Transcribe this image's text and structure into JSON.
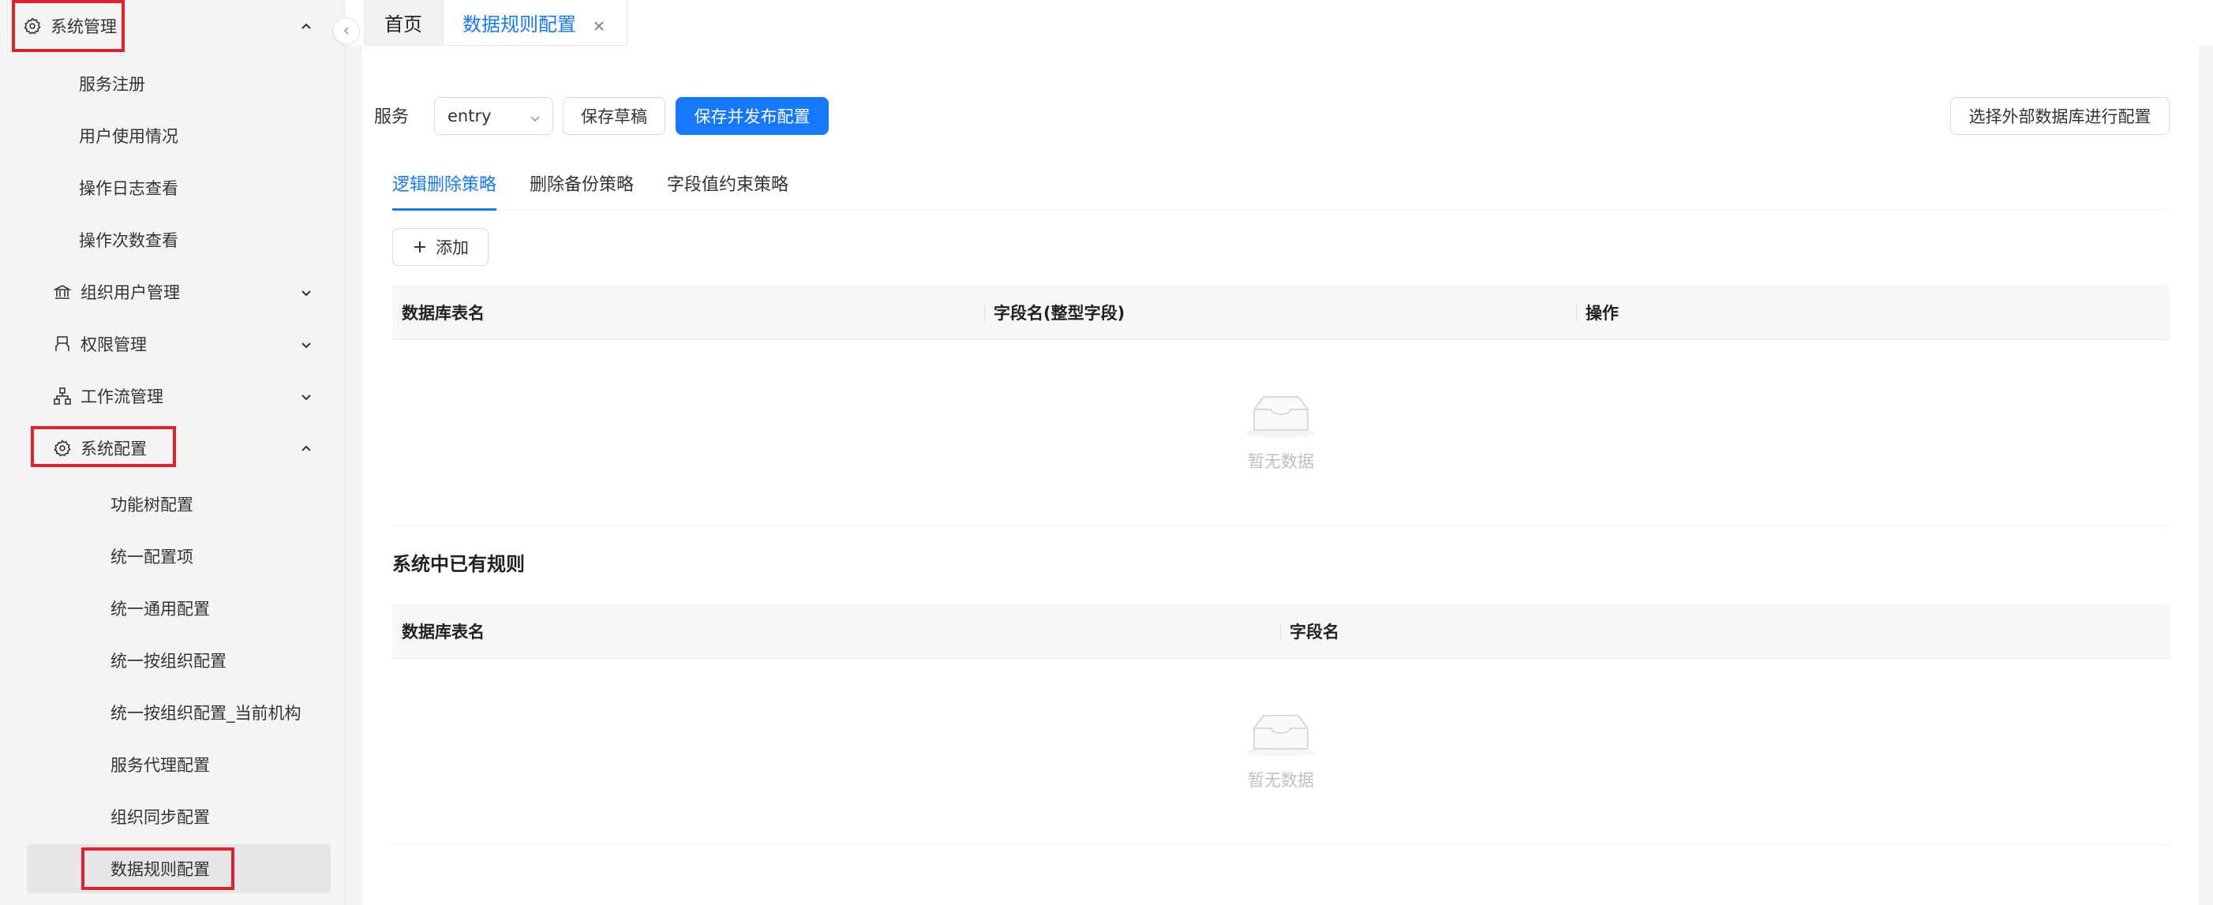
{
  "sidebar": {
    "group_system": "系统管理",
    "items_top": [
      "服务注册",
      "用户使用情况",
      "操作日志查看",
      "操作次数查看"
    ],
    "org_user": "组织用户管理",
    "permission": "权限管理",
    "workflow": "工作流管理",
    "sys_config": "系统配置",
    "config_items": [
      "功能树配置",
      "统一配置项",
      "统一通用配置",
      "统一按组织配置",
      "统一按组织配置_当前机构",
      "服务代理配置",
      "组织同步配置",
      "数据规则配置"
    ]
  },
  "tabs": {
    "home": "首页",
    "active": "数据规则配置"
  },
  "toolbar": {
    "service_label": "服务",
    "service_value": "entry",
    "save_draft": "保存草稿",
    "save_publish": "保存并发布配置",
    "external_db": "选择外部数据库进行配置"
  },
  "subtabs": [
    "逻辑删除策略",
    "删除备份策略",
    "字段值约束策略"
  ],
  "add_button": "添加",
  "table1": {
    "columns": [
      "数据库表名",
      "字段名(整型字段)",
      "操作"
    ],
    "empty_text": "暂无数据"
  },
  "section_title": "系统中已有规则",
  "table2": {
    "columns": [
      "数据库表名",
      "字段名"
    ],
    "empty_text": "暂无数据"
  },
  "colors": {
    "primary": "#1677ff",
    "highlight_box": "#e0202a"
  }
}
